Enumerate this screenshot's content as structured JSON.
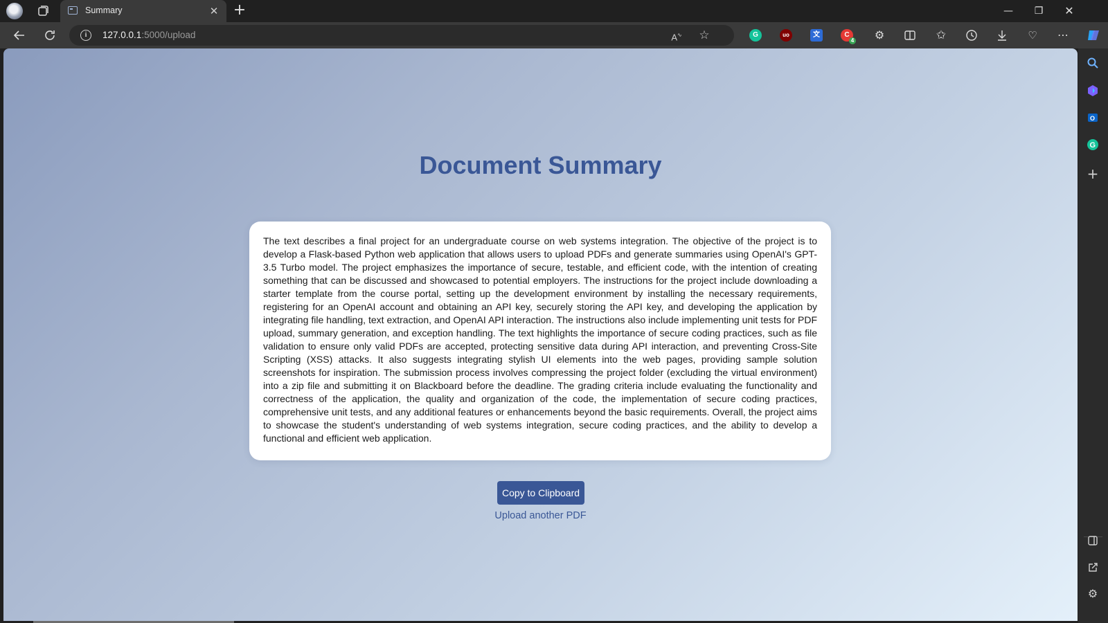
{
  "browser": {
    "tab": {
      "title": "Summary",
      "favicon": "terminal-window-icon"
    },
    "address": {
      "host": "127.0.0.1",
      "path": ":5000/upload"
    },
    "toolbar_icons": [
      "back-icon",
      "refresh-icon",
      "read-aloud-icon",
      "favorite-star-icon",
      "grammarly-icon",
      "ublock-icon",
      "translate-icon",
      "extension-badge-icon",
      "extensions-icon",
      "split-screen-icon",
      "favorites-icon",
      "history-icon",
      "downloads-icon",
      "browser-essentials-icon",
      "more-icon",
      "copilot-icon"
    ],
    "extension_badge_count": "4",
    "sidebar_icons": [
      "search-icon",
      "copilot-app-icon",
      "outlook-icon",
      "grammarly-icon",
      "add-icon",
      "sidebar-toggle-icon",
      "open-external-icon",
      "settings-icon"
    ]
  },
  "page": {
    "title": "Document Summary",
    "summary": "The text describes a final project for an undergraduate course on web systems integration. The objective of the project is to develop a Flask-based Python web application that allows users to upload PDFs and generate summaries using OpenAI's GPT-3.5 Turbo model. The project emphasizes the importance of secure, testable, and efficient code, with the intention of creating something that can be discussed and showcased to potential employers. The instructions for the project include downloading a starter template from the course portal, setting up the development environment by installing the necessary requirements, registering for an OpenAI account and obtaining an API key, securely storing the API key, and developing the application by integrating file handling, text extraction, and OpenAI API interaction. The instructions also include implementing unit tests for PDF upload, summary generation, and exception handling. The text highlights the importance of secure coding practices, such as file validation to ensure only valid PDFs are accepted, protecting sensitive data during API interaction, and preventing Cross-Site Scripting (XSS) attacks. It also suggests integrating stylish UI elements into the web pages, providing sample solution screenshots for inspiration. The submission process involves compressing the project folder (excluding the virtual environment) into a zip file and submitting it on Blackboard before the deadline. The grading criteria include evaluating the functionality and correctness of the application, the quality and organization of the code, the implementation of secure coding practices, comprehensive unit tests, and any additional features or enhancements beyond the basic requirements. Overall, the project aims to showcase the student's understanding of web systems integration, secure coding practices, and the ability to develop a functional and efficient web application.",
    "copy_button": "Copy to Clipboard",
    "upload_link": "Upload another PDF"
  },
  "colors": {
    "accent": "#3a5796",
    "background_start": "#8a9bbd",
    "background_end": "#e4f0fa"
  }
}
